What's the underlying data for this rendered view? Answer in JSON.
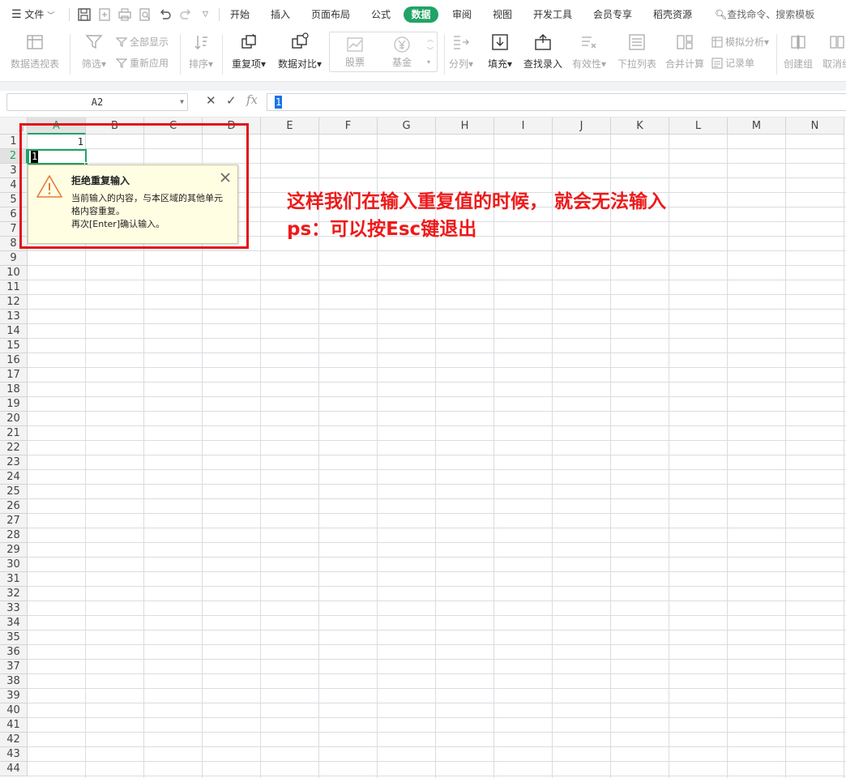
{
  "menu": {
    "file": "文件",
    "tabs": [
      "开始",
      "插入",
      "页面布局",
      "公式",
      "数据",
      "审阅",
      "视图",
      "开发工具",
      "会员专享",
      "稻壳资源"
    ],
    "active_tab": "数据",
    "search_placeholder": "查找命令、搜索模板"
  },
  "ribbon": {
    "pivot": "数据透视表",
    "filter": "筛选",
    "show_all": "全部显示",
    "reapply": "重新应用",
    "sort": "排序",
    "duplicates": "重复项",
    "compare": "数据对比",
    "stock": "股票",
    "fund": "基金",
    "split": "分列",
    "fill": "填充",
    "lookup": "查找录入",
    "validity": "有效性",
    "dropdown": "下拉列表",
    "consolidate": "合并计算",
    "simulate": "模拟分析",
    "record": "记录单",
    "group": "创建组",
    "ungroup": "取消组"
  },
  "formula_bar": {
    "name_box": "A2",
    "cancel": "✕",
    "confirm": "✓",
    "fx": "fx",
    "value": "1"
  },
  "sheet": {
    "columns": [
      "A",
      "B",
      "C",
      "D",
      "E",
      "F",
      "G",
      "H",
      "I",
      "J",
      "K",
      "L",
      "M",
      "N"
    ],
    "rows": [
      "1",
      "2",
      "3",
      "4",
      "5",
      "6",
      "7",
      "8",
      "9",
      "10",
      "11",
      "12",
      "13",
      "14",
      "15",
      "16",
      "17",
      "18",
      "19",
      "20",
      "21",
      "22",
      "23",
      "24",
      "25",
      "26",
      "27",
      "28",
      "29",
      "30",
      "31",
      "32",
      "33",
      "34",
      "35",
      "36",
      "37",
      "38",
      "39",
      "40",
      "41",
      "42",
      "43",
      "44"
    ],
    "a1": "1",
    "a2_edit": "1"
  },
  "popup": {
    "title": "拒绝重复输入",
    "line1": "当前输入的内容，与本区域的其他单元",
    "line2": "格内容重复。",
    "line3": "再次[Enter]确认输入。"
  },
  "annotation": {
    "line1": "这样我们在输入重复值的时候， 就会无法输入",
    "line2": "ps：可以按Esc键退出"
  },
  "colors": {
    "accent": "#21a366",
    "annotation": "#ee1a1a",
    "popup_bg": "#fffde2"
  }
}
